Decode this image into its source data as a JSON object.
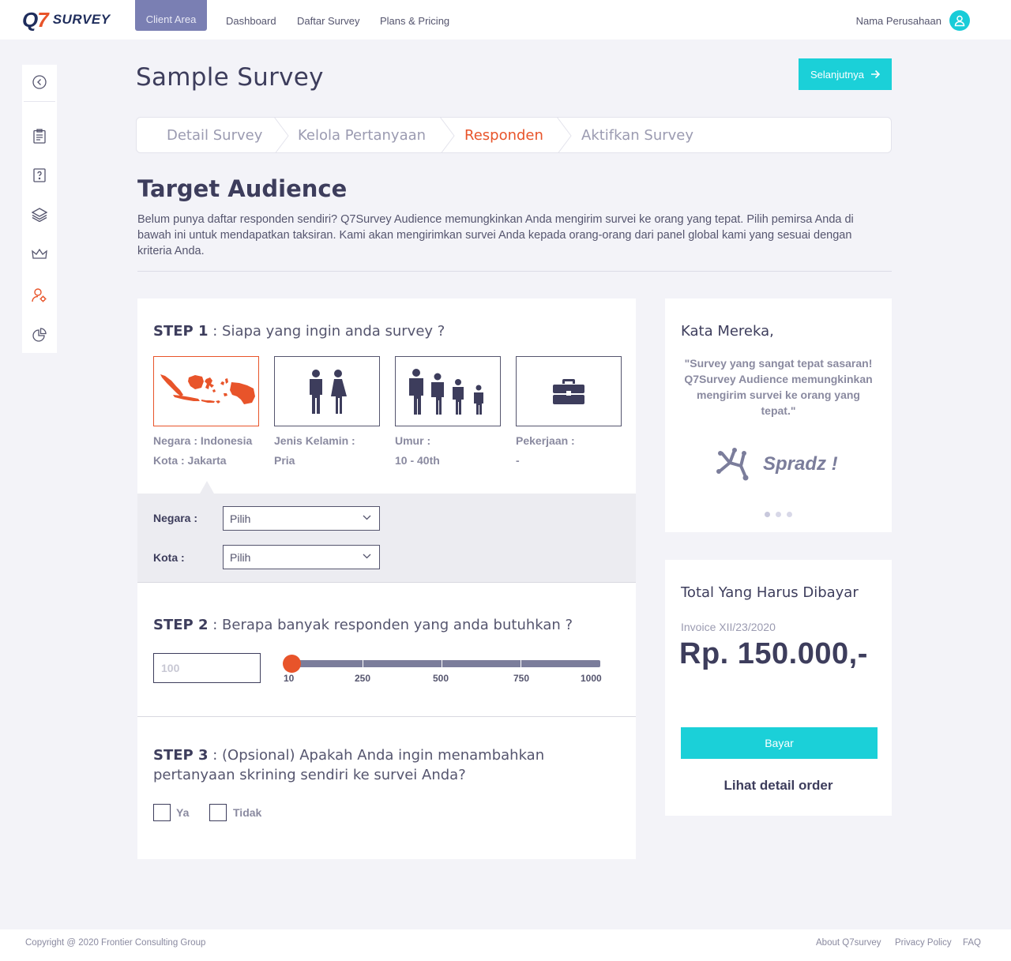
{
  "app": {
    "logo_q": "Q",
    "logo_seven": "7",
    "logo_word": "SURVEY"
  },
  "nav": {
    "client_area": "Client Area",
    "links": [
      "Dashboard",
      "Daftar Survey",
      "Plans & Pricing"
    ],
    "company": "Nama Perusahaan"
  },
  "sidebar": {
    "icons": [
      "back-circle-icon",
      "clipboard-icon",
      "question-icon",
      "layers-icon",
      "crown-icon",
      "user-settings-icon",
      "pie-chart-icon"
    ],
    "active": "user-settings-icon"
  },
  "page": {
    "title": "Sample Survey",
    "next_button": "Selanjutnya"
  },
  "steps": [
    "Detail Survey",
    "Kelola Pertanyaan",
    "Responden",
    "Aktifkan Survey"
  ],
  "active_step": "Responden",
  "audience": {
    "title": "Target Audience",
    "description": "Belum punya daftar responden sendiri? Q7Survey Audience memungkinkan Anda mengirim survei ke orang yang tepat. Pilih pemirsa Anda di bawah ini untuk mendapatkan taksiran. Kami akan mengirimkan survei Anda kepada orang-orang dari panel global kami yang sesuai dengan kriteria Anda."
  },
  "step1": {
    "label": "STEP 1",
    "question": " : Siapa yang ingin anda survey ?",
    "options": [
      {
        "icon": "indonesia-map-icon",
        "line1": "Negara : Indonesia",
        "line2": "Kota : Jakarta"
      },
      {
        "icon": "gender-icon",
        "line1": "Jenis Kelamin  :",
        "line2": "Pria"
      },
      {
        "icon": "age-group-icon",
        "line1": "Umur :",
        "line2": "10 - 40th"
      },
      {
        "icon": "briefcase-icon",
        "line1": "Pekerjaan :",
        "line2": "-"
      }
    ],
    "country_label": "Negara :",
    "country_value": "Pilih",
    "city_label": "Kota :",
    "city_value": "Pilih"
  },
  "step2": {
    "label": "STEP 2",
    "question": " : Berapa banyak responden yang anda butuhkan ?",
    "input_placeholder": "100",
    "slider_value": 10,
    "slider_ticks": [
      "10",
      "250",
      "500",
      "750",
      "1000"
    ]
  },
  "step3": {
    "label": "STEP 3",
    "question_line1": " : (Opsional) Apakah Anda ingin menambahkan",
    "question_line2": "pertanyaan skrining sendiri ke survei Anda?",
    "option_yes": "Ya",
    "option_no": "Tidak"
  },
  "testimonial": {
    "title": "Kata Mereka,",
    "quote": "\"Survey yang sangat tepat sasaran! Q7Survey Audience memungkinkan mengirim survei ke orang yang tepat.\"",
    "brand": "Spradz !"
  },
  "payment": {
    "title": "Total Yang Harus Dibayar",
    "invoice": "Invoice XII/23/2020",
    "amount": "Rp. 150.000,-",
    "pay_button": "Bayar",
    "detail_link": "Lihat detail order"
  },
  "footer": {
    "copyright": "Copyright @ 2020 Frontier Consulting Group",
    "links": [
      "About Q7survey",
      "Privacy Policy",
      "FAQ"
    ]
  },
  "colors": {
    "accent": "#e8542a",
    "teal": "#1bd0d8",
    "navy": "#3d3d5c",
    "nav_active": "#7a7fb3"
  }
}
